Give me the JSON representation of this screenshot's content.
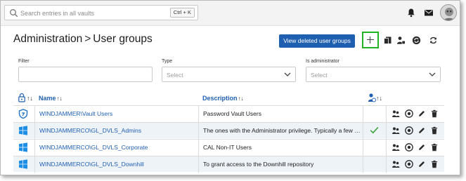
{
  "search": {
    "placeholder": "Search entries in all vaults",
    "shortcut": "Ctrl + K"
  },
  "header": {
    "section": "Administration",
    "separator": ">",
    "page": "User groups",
    "deleted_button": "View deleted user groups"
  },
  "filters": {
    "filter_label": "Filter",
    "filter_value": "",
    "type_label": "Type",
    "type_value": "Select",
    "admin_label": "Is administrator",
    "admin_value": "Select"
  },
  "columns": {
    "name": "Name",
    "description": "Description",
    "sort_glyph": "↑↓"
  },
  "rows": [
    {
      "name": "WINDJAMMER\\Vault Users",
      "description": "Password Vault Users",
      "is_admin": false,
      "icon": "vault-users-icon"
    },
    {
      "name": "WINDJAMMERCO\\GL_DVLS_Admins",
      "description": "The ones with the Administrator privilege. Typically a few …",
      "is_admin": true,
      "icon": "windows-icon"
    },
    {
      "name": "WINDJAMMERCO\\GL_DVLS_Corporate",
      "description": "CAL Non-IT Users",
      "is_admin": false,
      "icon": "windows-icon"
    },
    {
      "name": "WINDJAMMERCO\\GL_DVLS_Downhill",
      "description": "To grant access to the Downhill repository",
      "is_admin": false,
      "icon": "windows-icon"
    }
  ],
  "colors": {
    "accent": "#1f5fb0",
    "highlight": "#22b322",
    "check": "#3aa33a"
  }
}
